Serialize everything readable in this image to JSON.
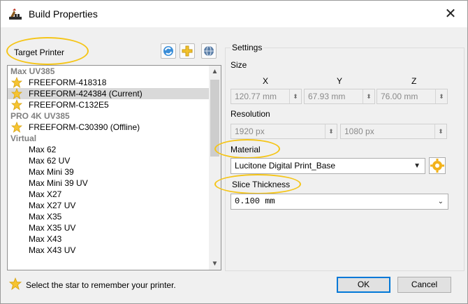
{
  "window": {
    "title": "Build Properties"
  },
  "target_printer": {
    "label": "Target Printer",
    "tree": {
      "groups": [
        {
          "name": "Max UV385",
          "items": [
            {
              "label": "FREEFORM-418318",
              "selected": false
            },
            {
              "label": "FREEFORM-424384 (Current)",
              "selected": true
            },
            {
              "label": "FREEFORM-C132E5",
              "selected": false
            }
          ]
        },
        {
          "name": "PRO 4K UV385",
          "items": [
            {
              "label": "FREEFORM-C30390 (Offline)",
              "selected": false
            }
          ]
        },
        {
          "name": "Virtual",
          "items": [
            {
              "label": "Max 62"
            },
            {
              "label": "Max 62 UV"
            },
            {
              "label": "Max Mini 39"
            },
            {
              "label": "Max Mini 39 UV"
            },
            {
              "label": "Max X27"
            },
            {
              "label": "Max X27 UV"
            },
            {
              "label": "Max X35"
            },
            {
              "label": "Max X35 UV"
            },
            {
              "label": "Max X43"
            },
            {
              "label": "Max X43 UV"
            }
          ]
        }
      ]
    }
  },
  "settings": {
    "legend": "Settings",
    "size": {
      "label": "Size",
      "x_label": "X",
      "y_label": "Y",
      "z_label": "Z",
      "x_value": "120.77 mm",
      "y_value": "67.93 mm",
      "z_value": "76.00 mm"
    },
    "resolution": {
      "label": "Resolution",
      "x_value": "1920 px",
      "y_value": "1080 px"
    },
    "material": {
      "label": "Material",
      "value": "Lucitone Digital Print_Base"
    },
    "slice_thickness": {
      "label": "Slice Thickness",
      "value": "0.100 mm"
    }
  },
  "footer": {
    "hint": "Select the star to remember your printer.",
    "ok_label": "OK",
    "cancel_label": "Cancel"
  },
  "colors": {
    "highlight": "#f5c518",
    "star": "#f6c431",
    "selected_row": "#d9d9d9",
    "default_button_border": "#0078d7"
  }
}
